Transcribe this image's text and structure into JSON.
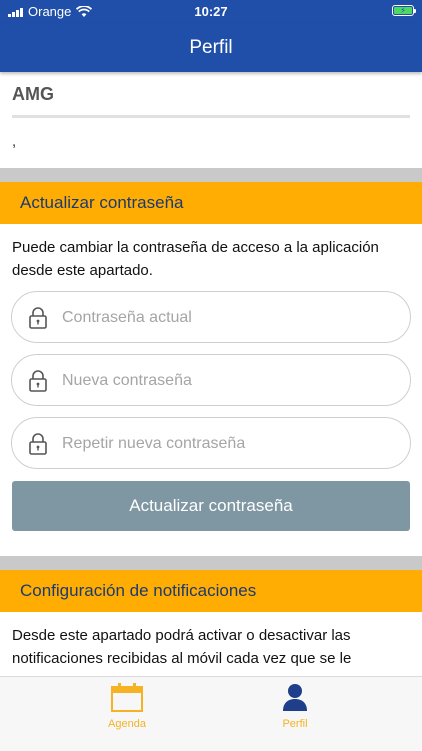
{
  "status_bar": {
    "carrier": "Orange",
    "time": "10:27"
  },
  "nav": {
    "title": "Perfil"
  },
  "user": {
    "name": "AMG",
    "extra": ","
  },
  "password_section": {
    "header": "Actualizar contraseña",
    "description": "Puede cambiar la contraseña de acceso a la aplicación desde este apartado.",
    "fields": [
      {
        "placeholder": "Contraseña actual"
      },
      {
        "placeholder": "Nueva contraseña"
      },
      {
        "placeholder": "Repetir nueva contraseña"
      }
    ],
    "button_label": "Actualizar contraseña"
  },
  "notifications_section": {
    "header": "Configuración de notificaciones",
    "description": "Desde este apartado podrá activar o desactivar las notificaciones recibidas al móvil cada vez que se le"
  },
  "tab_bar": {
    "tabs": [
      {
        "label": "Agenda",
        "icon": "calendar-icon"
      },
      {
        "label": "Perfil",
        "icon": "person-icon"
      }
    ],
    "active_color": "#f5b323"
  },
  "colors": {
    "nav_bg": "#1f4fa8",
    "section_header_bg": "#ffad03",
    "section_header_text": "#1d3a6e",
    "button_bg": "#7f96a3",
    "separator": "#c9c9c9"
  }
}
